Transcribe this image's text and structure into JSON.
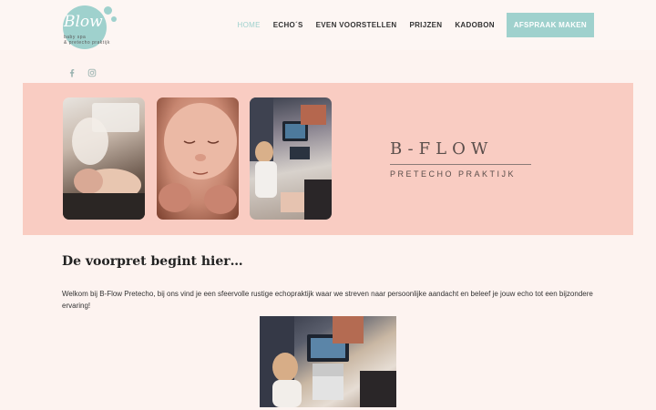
{
  "logo": {
    "main": "Blow",
    "sub": "baby spa",
    "sub2": "& pretecho praktijk",
    "color": "#9fd1cd"
  },
  "nav": {
    "items": [
      {
        "label": "HOME",
        "active": true
      },
      {
        "label": "ECHO´S"
      },
      {
        "label": "EVEN VOORSTELLEN"
      },
      {
        "label": "PRIJZEN"
      },
      {
        "label": "KADOBON"
      }
    ],
    "cta": "AFSPRAAK MAKEN"
  },
  "social": [
    "facebook-icon",
    "instagram-icon"
  ],
  "banner": {
    "title": "B-FLOW",
    "subtitle": "PRETECHO PRAKTIJK",
    "background": "#f9ccc2"
  },
  "content": {
    "heading": "De voorpret begint hier…",
    "intro": "Welkom bij B-Flow Pretecho, bij ons vind je een sfeervolle rustige echopraktijk waar we streven naar persoonlijke aandacht en beleef je jouw echo tot een bijzondere ervaring!"
  }
}
